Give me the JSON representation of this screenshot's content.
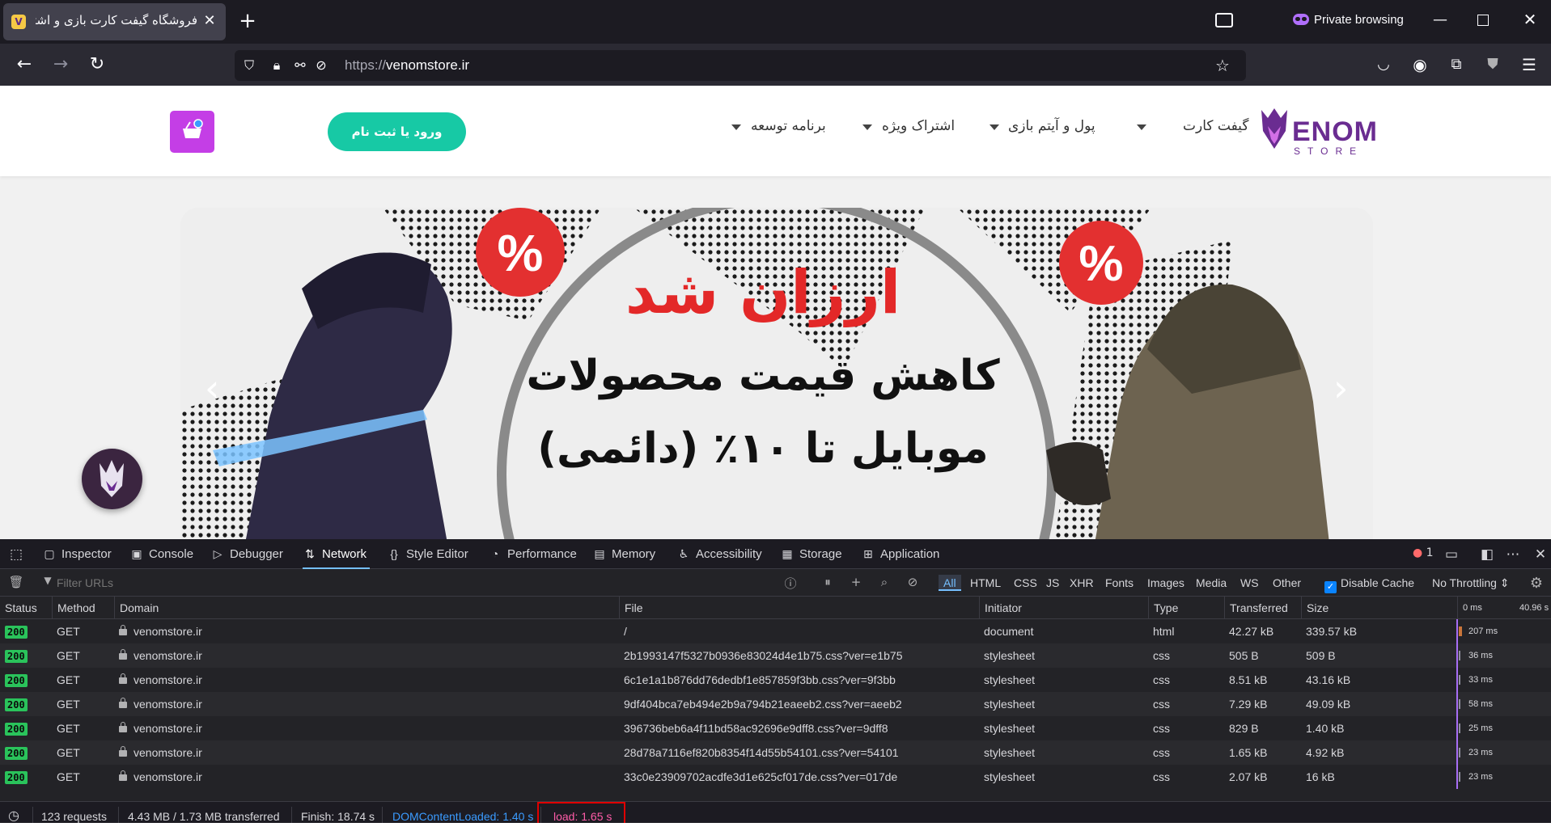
{
  "browser": {
    "tab_title": "فروشگاه گیفت کارت بازی و اشتراک",
    "private_label": "Private browsing",
    "url_scheme": "https://",
    "url_host": "venomstore.ir"
  },
  "site": {
    "logo_word": "ENOM",
    "logo_sub": "STORE",
    "menu": [
      {
        "label": "گیفت کارت"
      },
      {
        "label": "پول و آیتم بازی"
      },
      {
        "label": "اشتراک ویژه"
      },
      {
        "label": "برنامه توسعه"
      }
    ],
    "login_label": "ورود یا ثبت نام",
    "banner": {
      "headline": "ارزان شد",
      "line1": "کاهش قیمت محصولات",
      "line2": "موبایل تا ۱۰٪ (دائمی)",
      "percent_badge": "%"
    }
  },
  "devtools": {
    "tabs": [
      {
        "label": "Inspector",
        "icon": "inspector-icon"
      },
      {
        "label": "Console",
        "icon": "console-icon"
      },
      {
        "label": "Debugger",
        "icon": "debugger-icon"
      },
      {
        "label": "Network",
        "icon": "network-icon"
      },
      {
        "label": "Style Editor",
        "icon": "style-editor-icon"
      },
      {
        "label": "Performance",
        "icon": "performance-icon"
      },
      {
        "label": "Memory",
        "icon": "memory-icon"
      },
      {
        "label": "Accessibility",
        "icon": "accessibility-icon"
      },
      {
        "label": "Storage",
        "icon": "storage-icon"
      },
      {
        "label": "Application",
        "icon": "application-icon"
      }
    ],
    "error_count": "1",
    "filter_placeholder": "Filter URLs",
    "type_filters": [
      "All",
      "HTML",
      "CSS",
      "JS",
      "XHR",
      "Fonts",
      "Images",
      "Media",
      "WS",
      "Other"
    ],
    "disable_cache_label": "Disable Cache",
    "throttling_label": "No Throttling",
    "columns": [
      "Status",
      "Method",
      "Domain",
      "File",
      "Initiator",
      "Type",
      "Transferred",
      "Size"
    ],
    "waterfall_ticks": [
      "0 ms",
      "40.96 s"
    ],
    "requests": [
      {
        "status": "200",
        "method": "GET",
        "domain": "venomstore.ir",
        "file": "/",
        "initiator": "document",
        "type": "html",
        "transferred": "42.27 kB",
        "size": "339.57 kB",
        "time": "207 ms"
      },
      {
        "status": "200",
        "method": "GET",
        "domain": "venomstore.ir",
        "file": "2b1993147f5327b0936e83024d4e1b75.css?ver=e1b75",
        "initiator": "stylesheet",
        "type": "css",
        "transferred": "505 B",
        "size": "509 B",
        "time": "36 ms"
      },
      {
        "status": "200",
        "method": "GET",
        "domain": "venomstore.ir",
        "file": "6c1e1a1b876dd76dedbf1e857859f3bb.css?ver=9f3bb",
        "initiator": "stylesheet",
        "type": "css",
        "transferred": "8.51 kB",
        "size": "43.16 kB",
        "time": "33 ms"
      },
      {
        "status": "200",
        "method": "GET",
        "domain": "venomstore.ir",
        "file": "9df404bca7eb494e2b9a794b21eaeeb2.css?ver=aeeb2",
        "initiator": "stylesheet",
        "type": "css",
        "transferred": "7.29 kB",
        "size": "49.09 kB",
        "time": "58 ms"
      },
      {
        "status": "200",
        "method": "GET",
        "domain": "venomstore.ir",
        "file": "396736beb6a4f11bd58ac92696e9dff8.css?ver=9dff8",
        "initiator": "stylesheet",
        "type": "css",
        "transferred": "829 B",
        "size": "1.40 kB",
        "time": "25 ms"
      },
      {
        "status": "200",
        "method": "GET",
        "domain": "venomstore.ir",
        "file": "28d78a7116ef820b8354f14d55b54101.css?ver=54101",
        "initiator": "stylesheet",
        "type": "css",
        "transferred": "1.65 kB",
        "size": "4.92 kB",
        "time": "23 ms"
      },
      {
        "status": "200",
        "method": "GET",
        "domain": "venomstore.ir",
        "file": "33c0e23909702acdfe3d1e625cf017de.css?ver=017de",
        "initiator": "stylesheet",
        "type": "css",
        "transferred": "2.07 kB",
        "size": "16 kB",
        "time": "23 ms"
      }
    ],
    "summary": {
      "requests": "123 requests",
      "transferred": "4.43 MB / 1.73 MB transferred",
      "finish": "Finish: 18.74 s",
      "dom_content_loaded": "DOMContentLoaded: 1.40 s",
      "load": "load: 1.65 s"
    }
  },
  "colors": {
    "accent_teal": "#17c9a5",
    "accent_purple": "#c43ee6",
    "brand": "#6a2c91",
    "status_ok": "#2ac35b",
    "dcl_blue": "#3a9bff",
    "load_pink": "#ff5ca8"
  }
}
